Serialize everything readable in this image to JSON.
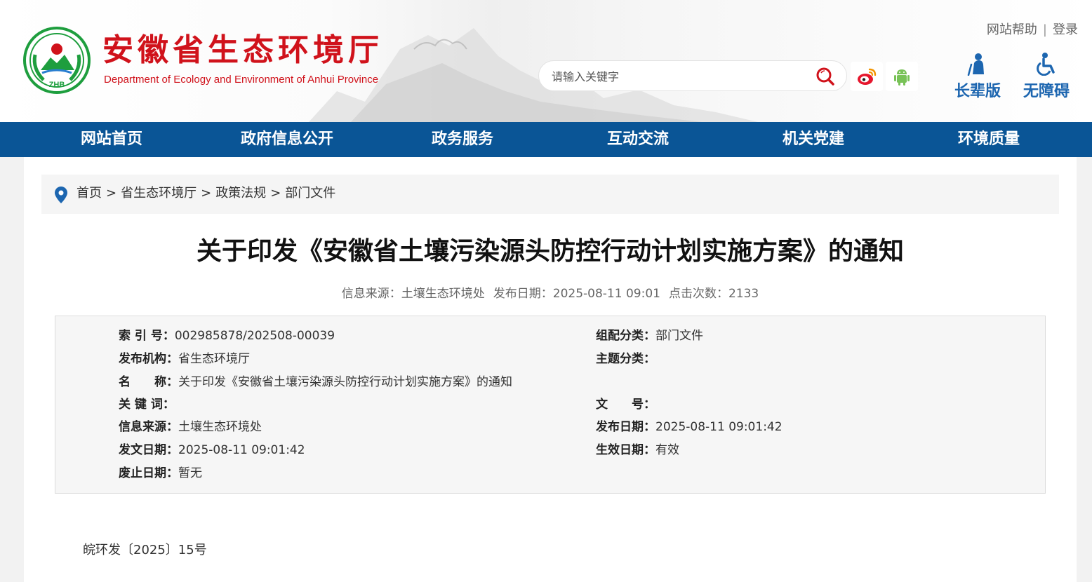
{
  "header": {
    "site_title": "安徽省生态环境厅",
    "site_subtitle": "Department of Ecology and Environment of Anhui Province",
    "logo_text": "ZHB",
    "top_links": {
      "help": "网站帮助",
      "separator": "|",
      "login": "登录"
    },
    "search": {
      "placeholder": "请输入关键字"
    },
    "accessibility": {
      "elder_label": "长辈版",
      "barrier_free_label": "无障碍"
    }
  },
  "nav": {
    "items": [
      "网站首页",
      "政府信息公开",
      "政务服务",
      "互动交流",
      "机关党建",
      "环境质量"
    ]
  },
  "breadcrumb": {
    "items": [
      "首页",
      "省生态环境厅",
      "政策法规",
      "部门文件"
    ],
    "separator": ">"
  },
  "article": {
    "title": "关于印发《安徽省土壤污染源头防控行动计划实施方案》的通知",
    "meta": {
      "source": "信息来源：土壤生态环境处",
      "publish_date": "发布日期：2025-08-11 09:01",
      "clicks": "点击次数：2133"
    },
    "info": {
      "index_no": {
        "key": "索 引 号：",
        "value": "002985878/202508-00039"
      },
      "category": {
        "key": "组配分类：",
        "value": "部门文件"
      },
      "issuer": {
        "key": "发布机构：",
        "value": "省生态环境厅"
      },
      "topic": {
        "key": "主题分类：",
        "value": ""
      },
      "name": {
        "key": "名　　称：",
        "value": "关于印发《安徽省土壤污染源头防控行动计划实施方案》的通知"
      },
      "keywords": {
        "key": "关 键 词：",
        "value": ""
      },
      "doc_no": {
        "key": "文　　号：",
        "value": ""
      },
      "info_source": {
        "key": "信息来源：",
        "value": "土壤生态环境处"
      },
      "publish_date": {
        "key": "发布日期：",
        "value": "2025-08-11 09:01:42"
      },
      "issue_date": {
        "key": "发文日期：",
        "value": "2025-08-11 09:01:42"
      },
      "effective_date": {
        "key": "生效日期：",
        "value": "有效"
      },
      "abolish_date": {
        "key": "废止日期：",
        "value": "暂无"
      }
    },
    "doc_number": "皖环发〔2025〕15号"
  },
  "colors": {
    "brand_red": "#d0121b",
    "nav_blue": "#0a5596",
    "accent_blue": "#1d66b0"
  }
}
